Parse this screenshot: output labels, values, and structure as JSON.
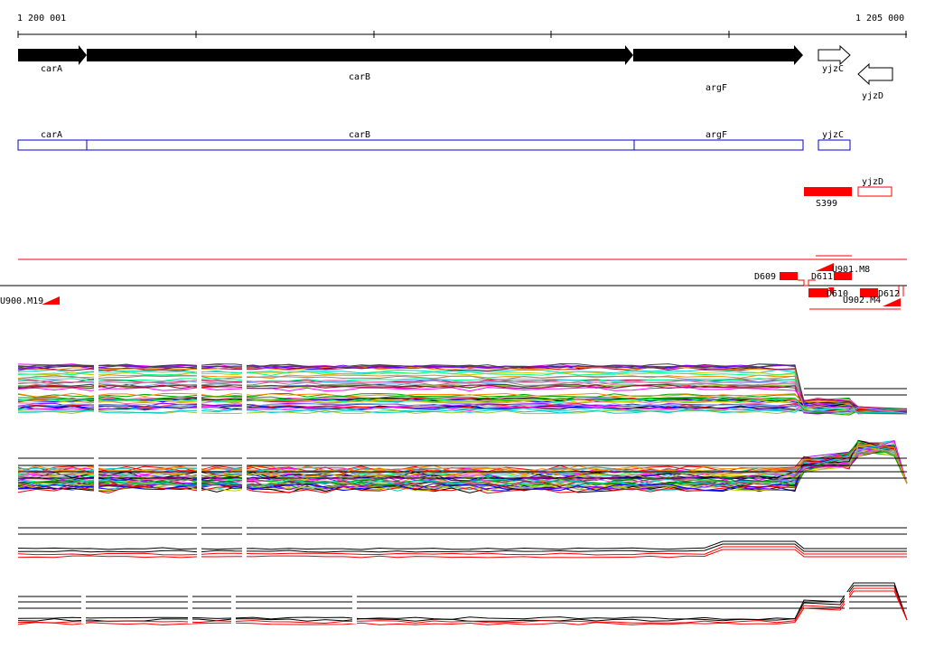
{
  "ruler": {
    "start_label": "1 200 001",
    "end_label": "1 205 000"
  },
  "genes_top": [
    {
      "name": "carA",
      "strand": "+"
    },
    {
      "name": "carB",
      "strand": "+"
    },
    {
      "name": "argF",
      "strand": "+"
    },
    {
      "name": "yjzC",
      "strand": "+"
    },
    {
      "name": "yjzD",
      "strand": "-"
    }
  ],
  "genes_boxes": [
    {
      "name": "carA"
    },
    {
      "name": "carB"
    },
    {
      "name": "argF"
    },
    {
      "name": "yjzC"
    }
  ],
  "red_features": [
    {
      "name": "yjzD"
    },
    {
      "name": "S399"
    }
  ],
  "segment_labels": [
    "D609",
    "D611",
    "U901.M8",
    "D610",
    "D612",
    "U902.M4",
    "U900.M19"
  ],
  "colors": {
    "gene_arrow": "#000000",
    "gene_box": "#0000cc",
    "feature": "#ff0000",
    "axis": "#000000"
  }
}
